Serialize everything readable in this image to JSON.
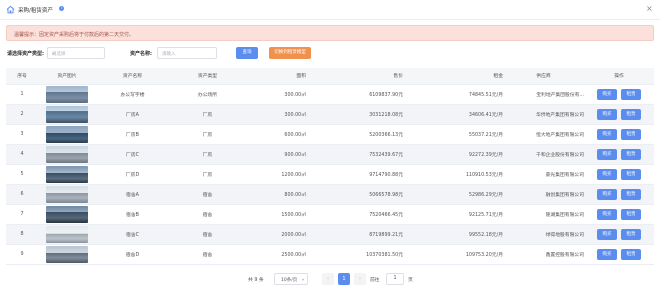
{
  "header": {
    "title": "采购/租赁资产",
    "info_glyph": "i",
    "close_glyph": "×",
    "home_icon": "home-icon"
  },
  "notice": {
    "text": "温馨提示：固定资产采购后将于付款后的第二天交付。"
  },
  "filters": {
    "type_label": "请选择资产类型:",
    "type_placeholder": "请选择",
    "name_label": "资产名称:",
    "name_placeholder": "请输入",
    "query_button": "查询",
    "secondary_button": "切换到租赁模型",
    "caret": "▾"
  },
  "colors": {
    "primary": "#5b8def",
    "orange": "#f0914d",
    "notice_bg": "#fbe0db",
    "notice_text": "#a1584a"
  },
  "table": {
    "columns": [
      "序号",
      "资产图片",
      "资产名称",
      "资产类型",
      "面积",
      "售价",
      "租金",
      "供应商",
      "操作"
    ],
    "buy_label": "购买",
    "rent_label": "租赁",
    "rows": [
      {
        "index": "1",
        "name": "办公写字楼",
        "type": "办公场所",
        "area": "300.00㎡",
        "price": "6109837.90元",
        "rent": "74845.51元/月",
        "supplier": "宝利地产集团股份有..."
      },
      {
        "index": "2",
        "name": "厂房A",
        "type": "厂房",
        "area": "300.00㎡",
        "price": "3031218.08元",
        "rent": "34606.41元/月",
        "supplier": "华侨地产集团有限公司"
      },
      {
        "index": "3",
        "name": "厂房B",
        "type": "厂房",
        "area": "600.00㎡",
        "price": "5200366.13元",
        "rent": "55037.21元/月",
        "supplier": "恒大地产集团有限公司"
      },
      {
        "index": "4",
        "name": "厂房C",
        "type": "厂房",
        "area": "900.00㎡",
        "price": "7532439.67元",
        "rent": "92272.39元/月",
        "supplier": "千和企业股份有限公司"
      },
      {
        "index": "5",
        "name": "厂房D",
        "type": "厂房",
        "area": "1200.00㎡",
        "price": "9714790.88元",
        "rent": "110910.53元/月",
        "supplier": "豪光集团有限公司"
      },
      {
        "index": "6",
        "name": "宿舍A",
        "type": "宿舍",
        "area": "800.00㎡",
        "price": "5066578.98元",
        "rent": "52986.29元/月",
        "supplier": "融创集团有限公司"
      },
      {
        "index": "7",
        "name": "宿舍B",
        "type": "宿舍",
        "area": "1500.00㎡",
        "price": "7520466.45元",
        "rent": "92125.71元/月",
        "supplier": "隆湖集团有限公司"
      },
      {
        "index": "8",
        "name": "宿舍C",
        "type": "宿舍",
        "area": "2000.00㎡",
        "price": "8719899.21元",
        "rent": "99552.18元/月",
        "supplier": "绿得地股有限公司"
      },
      {
        "index": "9",
        "name": "宿舍D",
        "type": "宿舍",
        "area": "2500.00㎡",
        "price": "10370381.50元",
        "rent": "109753.20元/月",
        "supplier": "鑫置控股有限公司"
      }
    ]
  },
  "pagination": {
    "total": "共 9 条",
    "page_size": "10条/页",
    "prev": "‹",
    "current_page": "1",
    "next": "›",
    "goto_label": "前往",
    "goto_value": "1",
    "page_suffix": "页"
  }
}
